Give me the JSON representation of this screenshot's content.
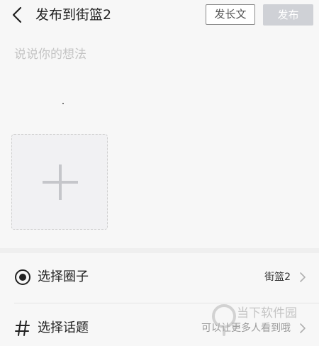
{
  "header": {
    "back_icon": "back-arrow-icon",
    "title": "发布到街篮2",
    "long_post_label": "发长文",
    "publish_label": "发布"
  },
  "composer": {
    "placeholder": "说说你的想法",
    "add_photo_icon": "plus-icon"
  },
  "options": {
    "circle": {
      "icon": "radio-circle-icon",
      "label": "选择圈子",
      "value": "街篮2"
    },
    "topic": {
      "icon": "hashtag-icon",
      "label": "选择话题",
      "value": "可以让更多人看到哦"
    }
  },
  "watermark": {
    "text": "当下软件园"
  },
  "colors": {
    "background": "#f7f7f7",
    "publish_button_bg": "#cfd1d6",
    "placeholder_text": "#c4c4c4"
  }
}
